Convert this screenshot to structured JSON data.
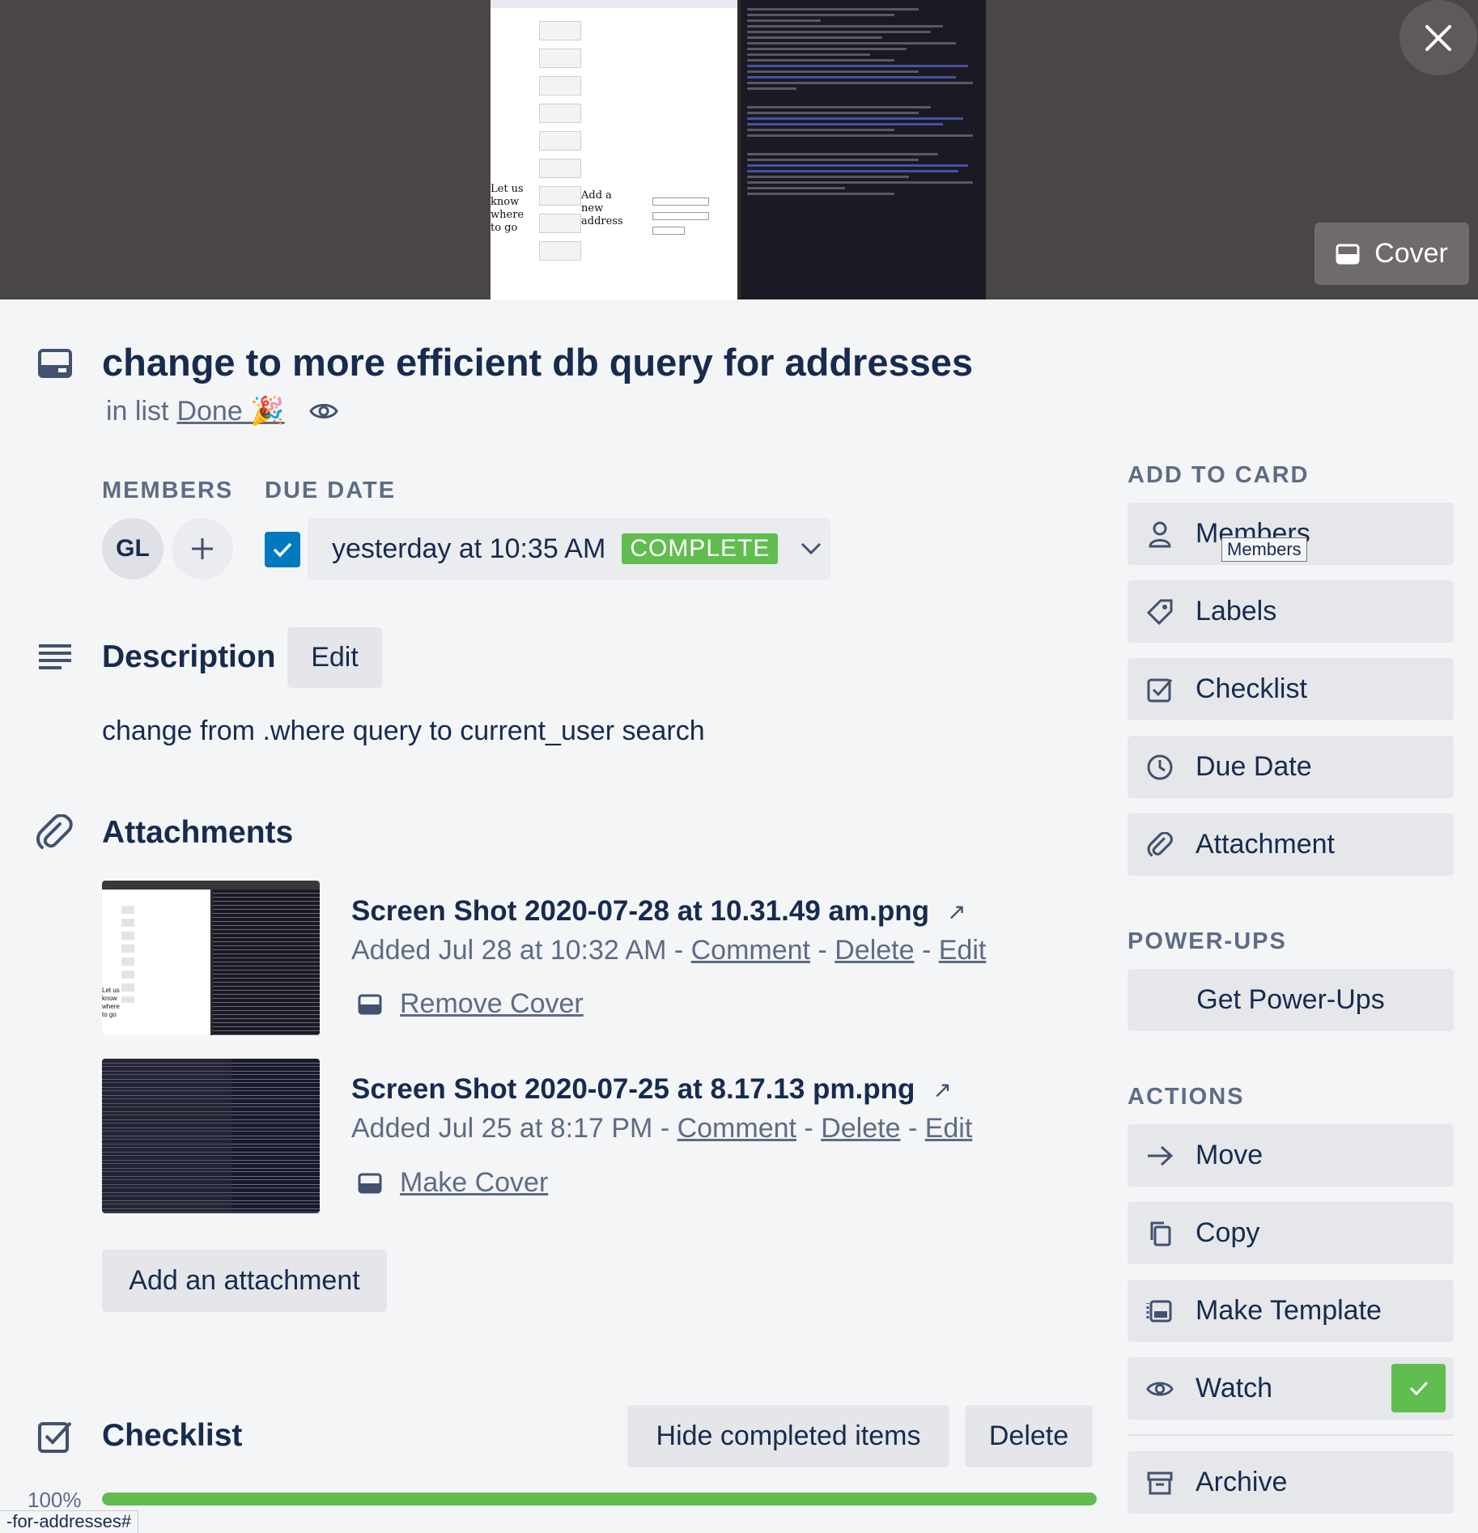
{
  "cover": {
    "close_icon": "close-icon",
    "cover_button_label": "Cover",
    "shot_left": {
      "side_text": "Let us know where to go",
      "add_text": "Add a new address"
    }
  },
  "card": {
    "title": "change to more efficient db query for addresses",
    "in_list_prefix": "in list",
    "list_name": "Done 🎉",
    "members_label": "MEMBERS",
    "member_initials": "GL",
    "due_label": "DUE DATE",
    "due_date": "yesterday at 10:35 AM",
    "due_status": "COMPLETE",
    "due_checked": true
  },
  "description": {
    "heading": "Description",
    "edit_label": "Edit",
    "text": "change from .where query to current_user search"
  },
  "attachments": {
    "heading": "Attachments",
    "items": [
      {
        "name": "Screen Shot 2020-07-28 at 10.31.49 am.png",
        "added": "Added Jul 28 at 10:32 AM",
        "sep": "-",
        "comment": "Comment",
        "delete": "Delete",
        "edit": "Edit",
        "cover_action": "Remove Cover"
      },
      {
        "name": "Screen Shot 2020-07-25 at 8.17.13 pm.png",
        "added": "Added Jul 25 at 8:17 PM",
        "sep": "-",
        "comment": "Comment",
        "delete": "Delete",
        "edit": "Edit",
        "cover_action": "Make Cover"
      }
    ],
    "external_link_glyph": "↗",
    "add_label": "Add an attachment"
  },
  "checklist": {
    "heading": "Checklist",
    "hide_completed_label": "Hide completed items",
    "delete_label": "Delete",
    "progress_percent": 100,
    "progress_label": "100%"
  },
  "url_tooltip": "-for-addresses#",
  "sidebar": {
    "add_to_card_label": "ADD TO CARD",
    "add_to_card": [
      {
        "label": "Members",
        "icon": "person-icon"
      },
      {
        "label": "Labels",
        "icon": "tag-icon"
      },
      {
        "label": "Checklist",
        "icon": "checkbox-icon"
      },
      {
        "label": "Due Date",
        "icon": "clock-icon"
      },
      {
        "label": "Attachment",
        "icon": "paperclip-icon"
      }
    ],
    "tooltip": "Members",
    "powerups_label": "POWER-UPS",
    "get_powerups": "Get Power-Ups",
    "actions_label": "ACTIONS",
    "actions": [
      {
        "label": "Move",
        "icon": "arrow-right-icon"
      },
      {
        "label": "Copy",
        "icon": "copy-icon"
      },
      {
        "label": "Make Template",
        "icon": "template-icon"
      },
      {
        "label": "Watch",
        "icon": "eye-icon",
        "active": true
      },
      {
        "label": "Archive",
        "icon": "archive-icon"
      }
    ]
  },
  "colors": {
    "background": "#f4f5f7",
    "text": "#172b4d",
    "muted": "#5e6c84",
    "success": "#61bd4f",
    "check_blue": "#0079bf",
    "cover_bg": "#4a4547"
  }
}
